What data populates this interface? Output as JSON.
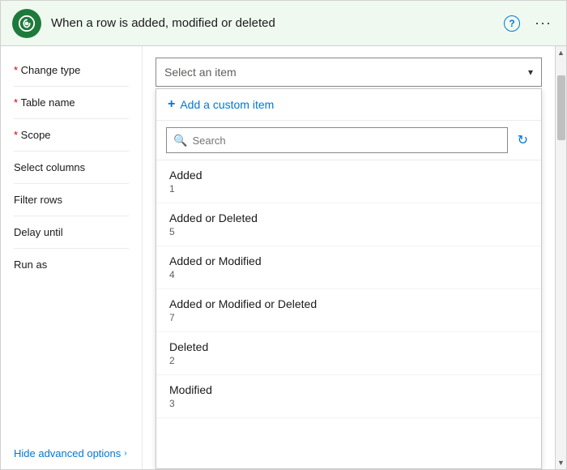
{
  "header": {
    "title": "When a row is added, modified or deleted",
    "help_icon": "?",
    "more_icon": "···"
  },
  "left_panel": {
    "fields": [
      {
        "label": "Change type",
        "required": true
      },
      {
        "label": "Table name",
        "required": true
      },
      {
        "label": "Scope",
        "required": true
      },
      {
        "label": "Select columns",
        "required": false
      },
      {
        "label": "Filter rows",
        "required": false
      },
      {
        "label": "Delay until",
        "required": false
      },
      {
        "label": "Run as",
        "required": false
      }
    ],
    "advanced_link": "Hide advanced options"
  },
  "right_panel": {
    "select_placeholder": "Select an item",
    "chevron": "▾",
    "add_custom_label": "Add a custom item",
    "search_placeholder": "Search",
    "items": [
      {
        "name": "Added",
        "value": "1"
      },
      {
        "name": "Added or Deleted",
        "value": "5"
      },
      {
        "name": "Added or Modified",
        "value": "4"
      },
      {
        "name": "Added or Modified or Deleted",
        "value": "7"
      },
      {
        "name": "Deleted",
        "value": "2"
      },
      {
        "name": "Modified",
        "value": "3"
      }
    ]
  }
}
